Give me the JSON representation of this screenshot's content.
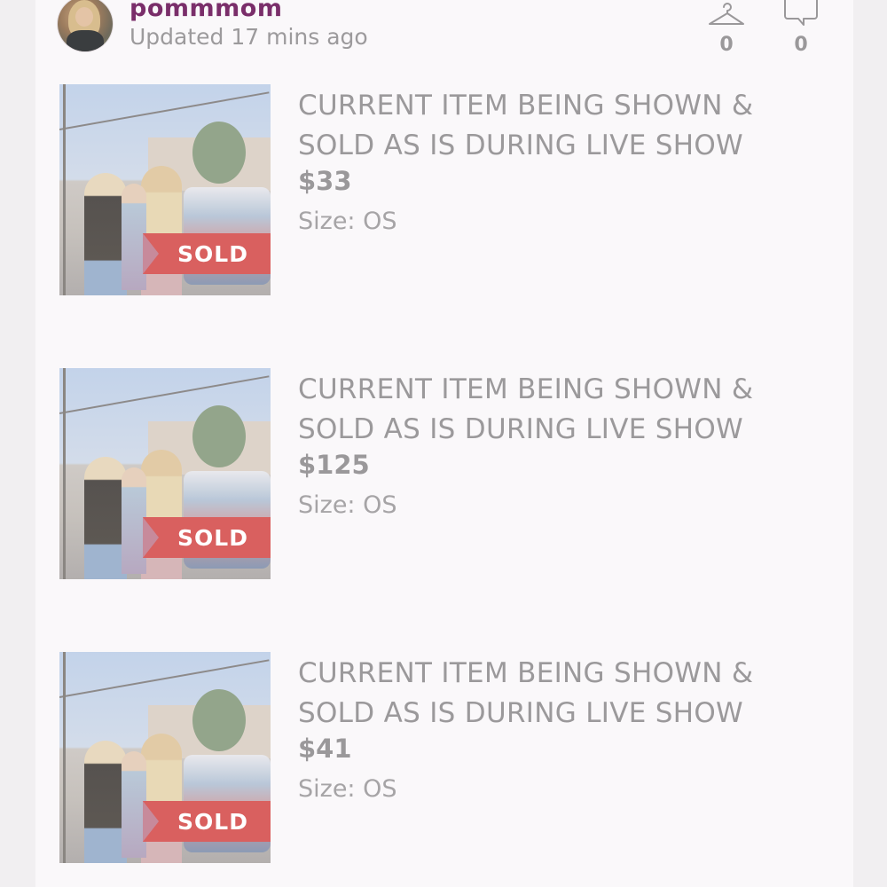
{
  "header": {
    "username": "pommmom",
    "updated": "Updated 17 mins ago",
    "likes_icon": "hanger-icon",
    "likes_count": "0",
    "comments_icon": "comment-bubble-icon",
    "comments_count": "0"
  },
  "listings": [
    {
      "title_line1": "CURRENT ITEM BEING SHOWN &",
      "title_line2": "SOLD AS IS DURING LIVE SHOW",
      "price": "$33",
      "size": "Size: OS",
      "badge": "SOLD"
    },
    {
      "title_line1": "CURRENT ITEM BEING SHOWN &",
      "title_line2": "SOLD AS IS DURING LIVE SHOW",
      "price": "$125",
      "size": "Size: OS",
      "badge": "SOLD"
    },
    {
      "title_line1": "CURRENT ITEM BEING SHOWN &",
      "title_line2": "SOLD AS IS DURING LIVE SHOW",
      "price": "$41",
      "size": "Size: OS",
      "badge": "SOLD"
    }
  ],
  "colors": {
    "username": "#7a2e6a",
    "sold_banner": "#d9605f",
    "card_background": "#faf8fa"
  }
}
